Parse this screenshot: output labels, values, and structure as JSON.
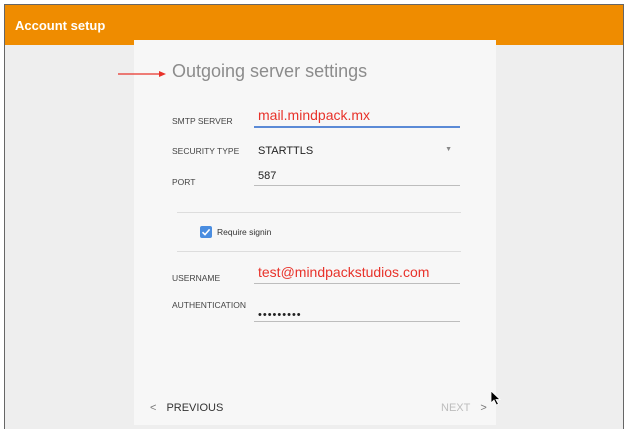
{
  "window": {
    "title": "Account setup"
  },
  "heading": "Outgoing server settings",
  "fields": {
    "smtp_server": {
      "label": "SMTP SERVER",
      "value": "mail.mindpack.mx"
    },
    "security_type": {
      "label": "SECURITY TYPE",
      "value": "STARTTLS"
    },
    "port": {
      "label": "PORT",
      "value": "587"
    },
    "require_signin": {
      "label": "Require signin",
      "checked": true
    },
    "username": {
      "label": "USERNAME",
      "value": "test@mindpackstudios.com"
    },
    "authentication": {
      "label": "AUTHENTICATION",
      "value": "•••••••••"
    }
  },
  "nav": {
    "previous_label": "PREVIOUS",
    "next_label": "NEXT",
    "next_enabled": false
  },
  "colors": {
    "topbar": "#ef8c00",
    "accent": "#5b8ad6",
    "annotation": "#e8322a"
  },
  "icons": [
    "annotation-arrow-icon",
    "chevron-down-icon",
    "checkmark-icon",
    "chevron-left-icon",
    "chevron-right-icon",
    "mouse-pointer-icon"
  ]
}
